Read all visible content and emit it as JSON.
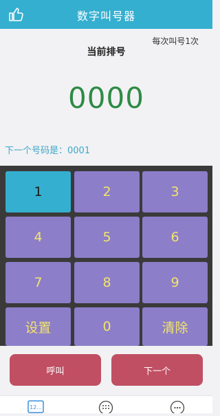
{
  "header": {
    "title": "数字叫号器",
    "thumb_icon": "thumbs-up-icon"
  },
  "display": {
    "mode_label": "每次叫号1次",
    "queue_label": "当前排号",
    "current_number": "0000",
    "next_line": "下一个号码是：0001"
  },
  "keypad": {
    "keys": [
      "1",
      "2",
      "3",
      "4",
      "5",
      "6",
      "7",
      "8",
      "9",
      "设置",
      "0",
      "清除"
    ],
    "active_key": "1",
    "key_color": "#8c7ec8",
    "active_color": "#35afd0",
    "text_color": "#f2e56b"
  },
  "actions": {
    "call_label": "呼叫",
    "next_label": "下一个"
  },
  "tabs": {
    "keypad_tab_label": "12...",
    "dialpad_icon": "dialpad-icon",
    "more_icon": "more-icon"
  },
  "colors": {
    "header": "#35afd0",
    "action": "#c04f63",
    "number": "#2e8b45"
  }
}
